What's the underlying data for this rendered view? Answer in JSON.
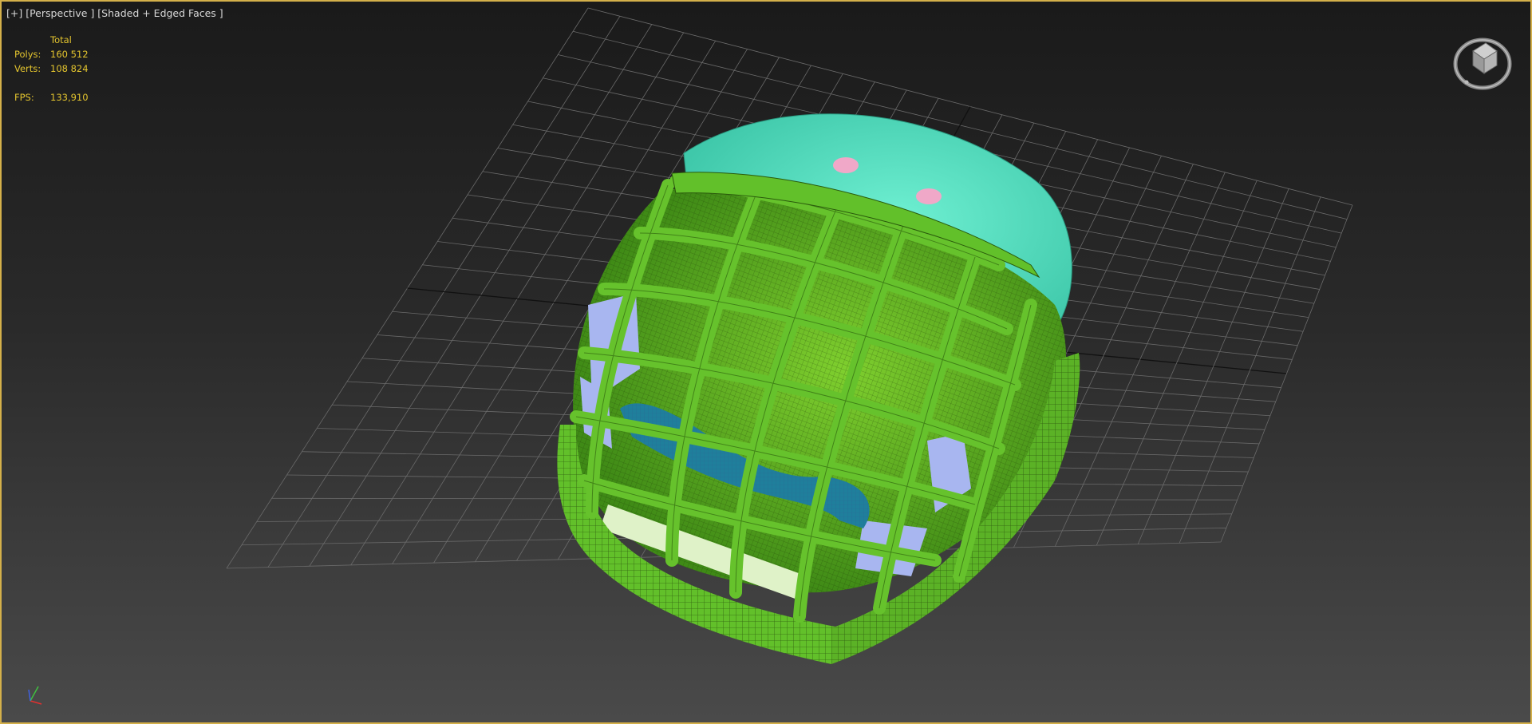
{
  "viewport": {
    "label": "[+] [Perspective ] [Shaded + Edged Faces ]",
    "stats": {
      "header": "Total",
      "rows": [
        {
          "key": "Polys:",
          "value": "160 512"
        },
        {
          "key": "Verts:",
          "value": "108 824"
        },
        {
          "key": "FPS:",
          "value": "133,910"
        }
      ]
    },
    "viewcube_icon": "viewcube-icon",
    "axis_icon": "axis-tripod-icon",
    "colors": {
      "frame_border": "#d4b04a",
      "stats_text": "#e4c52e",
      "cage_green": "#62c02a",
      "shell_cyan": "#5fe0c3",
      "padding_lavender": "#a8b6f0",
      "chin_cup_blue": "#1f7f9c",
      "snap_pink": "#f0a8c8"
    }
  }
}
